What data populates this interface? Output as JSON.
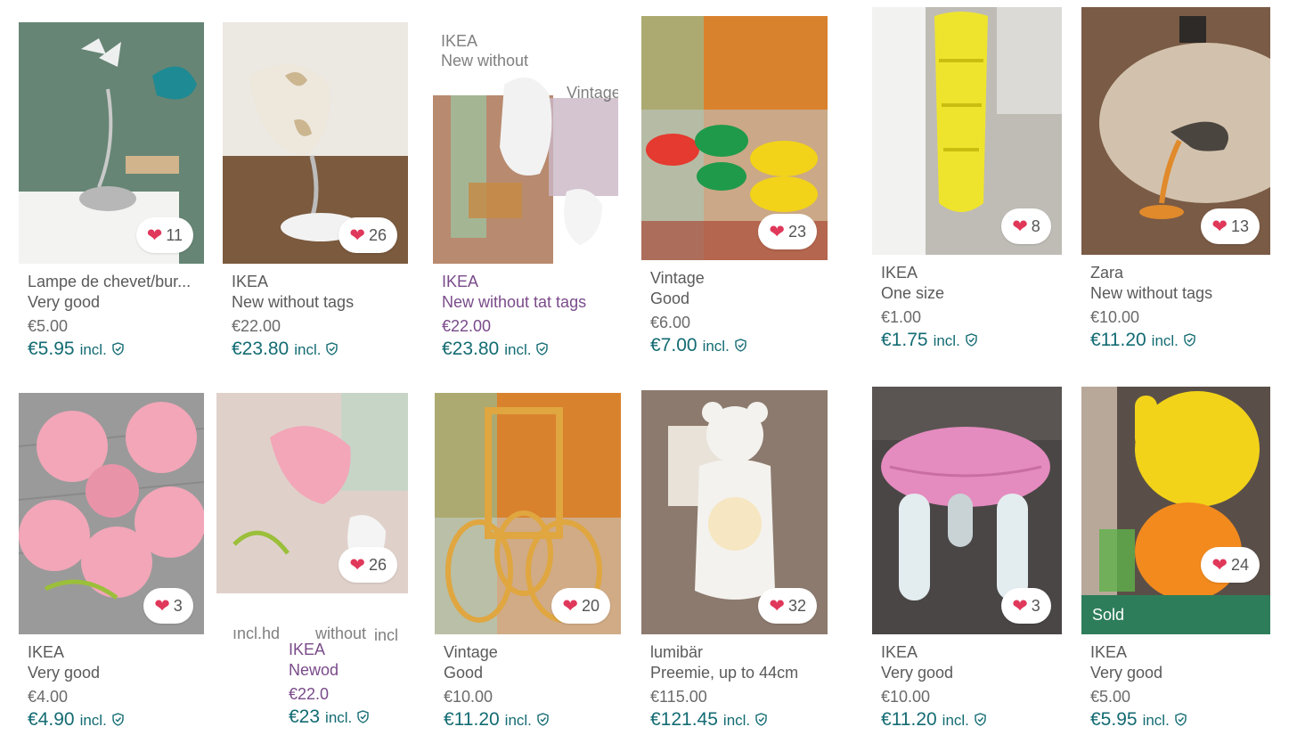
{
  "items": [
    {
      "brand": "Lampe de chevet/bur...",
      "condition": "Very good",
      "price": "€5.00",
      "price_incl": "€5.95",
      "incl_label": "incl.",
      "likes": "11",
      "photo": "teal-desk-lamp-on-radiator",
      "bg": "#5c7f6f",
      "accent": "#1e8a93"
    },
    {
      "brand": "IKEA",
      "condition": "New without tags",
      "price": "€22.00",
      "price_incl": "€23.80",
      "incl_label": "incl.",
      "likes": "26",
      "photo": "white-cloud-clamp-lamp",
      "bg": "#e9e5df",
      "accent": "#8c6a4a"
    },
    {
      "brand": "IKEA",
      "condition": "New without tat tags",
      "price": "€22.00",
      "price_incl": "€23.80",
      "incl_label": "incl.",
      "likes": "",
      "photo": "white-bear-lamp-collage",
      "bg": "#b88a6f",
      "accent": "#f4f4f4",
      "overlay_brand": "IKEA",
      "overlay_cond": "New without",
      "overlay_vintage": "Vintage"
    },
    {
      "brand": "Vintage",
      "condition": "Good",
      "price": "€6.00",
      "price_incl": "€7.00",
      "incl_label": "incl.",
      "likes": "23",
      "photo": "colorful-egg-cups",
      "bg": "#d9822e",
      "accent": "#f2d319"
    },
    {
      "brand": "IKEA",
      "condition": "One size",
      "price": "€1.00",
      "price_incl": "€1.75",
      "incl_label": "incl.",
      "likes": "8",
      "photo": "yellow-hanging-mesh-storage",
      "bg": "#bfbcb6",
      "accent": "#f1e626"
    },
    {
      "brand": "Zara",
      "condition": "New without tags",
      "price": "€10.00",
      "price_incl": "€11.20",
      "incl_label": "incl.",
      "likes": "13",
      "photo": "orange-desk-lamp",
      "bg": "#7a5b45",
      "accent": "#e08a2c"
    },
    {
      "brand": "IKEA",
      "condition": "Very good",
      "price": "€4.00",
      "price_incl": "€4.90",
      "incl_label": "incl.",
      "likes": "3",
      "photo": "pink-flower-wall-lamp",
      "bg": "#9a9a9a",
      "accent": "#f2a6b8"
    },
    {
      "brand": "IKEA",
      "condition": "Newod",
      "price": "€22.0",
      "price_incl": "€23",
      "incl_label": "incl.",
      "likes": "26",
      "photo": "pink-flower-lamp-collage",
      "bg": "#c9b2a7",
      "accent": "#f2a6b8",
      "overlay_incl": "ıncl.hd",
      "overlay_without": "without",
      "overlay_incl2": "incl"
    },
    {
      "brand": "Vintage",
      "condition": "Good",
      "price": "€10.00",
      "price_incl": "€11.20",
      "incl_label": "incl.",
      "likes": "20",
      "photo": "orange-bottle-carrier",
      "bg": "#d9822e",
      "accent": "#e0a640"
    },
    {
      "brand": "lumibär",
      "condition": "Preemie, up to 44cm",
      "price": "€115.00",
      "price_incl": "€121.45",
      "incl_label": "incl.",
      "likes": "32",
      "photo": "glowing-bear-lamp",
      "bg": "#8c7a6e",
      "accent": "#f4f2ee"
    },
    {
      "brand": "IKEA",
      "condition": "Very good",
      "price": "€10.00",
      "price_incl": "€11.20",
      "incl_label": "incl.",
      "likes": "3",
      "photo": "pink-cushioned-stool",
      "bg": "#4a4646",
      "accent": "#e48bbf"
    },
    {
      "brand": "IKEA",
      "condition": "Very good",
      "price": "€5.00",
      "price_incl": "€5.95",
      "incl_label": "incl.",
      "likes": "24",
      "sold": "Sold",
      "photo": "yellow-orange-kids-chairs",
      "bg": "#5a4f48",
      "accent": "#f2d319"
    }
  ]
}
